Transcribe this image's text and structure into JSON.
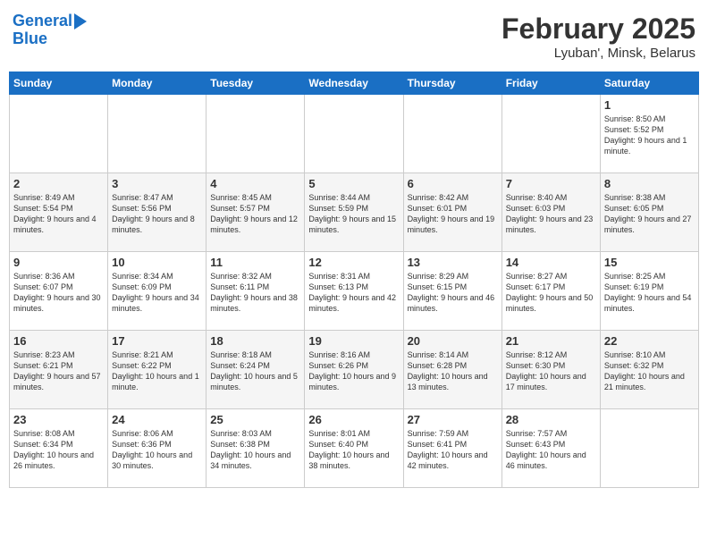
{
  "logo": {
    "line1": "General",
    "line2": "Blue"
  },
  "title": "February 2025",
  "subtitle": "Lyuban', Minsk, Belarus",
  "weekdays": [
    "Sunday",
    "Monday",
    "Tuesday",
    "Wednesday",
    "Thursday",
    "Friday",
    "Saturday"
  ],
  "weeks": [
    [
      {
        "day": "",
        "info": ""
      },
      {
        "day": "",
        "info": ""
      },
      {
        "day": "",
        "info": ""
      },
      {
        "day": "",
        "info": ""
      },
      {
        "day": "",
        "info": ""
      },
      {
        "day": "",
        "info": ""
      },
      {
        "day": "1",
        "info": "Sunrise: 8:50 AM\nSunset: 5:52 PM\nDaylight: 9 hours and 1 minute."
      }
    ],
    [
      {
        "day": "2",
        "info": "Sunrise: 8:49 AM\nSunset: 5:54 PM\nDaylight: 9 hours and 4 minutes."
      },
      {
        "day": "3",
        "info": "Sunrise: 8:47 AM\nSunset: 5:56 PM\nDaylight: 9 hours and 8 minutes."
      },
      {
        "day": "4",
        "info": "Sunrise: 8:45 AM\nSunset: 5:57 PM\nDaylight: 9 hours and 12 minutes."
      },
      {
        "day": "5",
        "info": "Sunrise: 8:44 AM\nSunset: 5:59 PM\nDaylight: 9 hours and 15 minutes."
      },
      {
        "day": "6",
        "info": "Sunrise: 8:42 AM\nSunset: 6:01 PM\nDaylight: 9 hours and 19 minutes."
      },
      {
        "day": "7",
        "info": "Sunrise: 8:40 AM\nSunset: 6:03 PM\nDaylight: 9 hours and 23 minutes."
      },
      {
        "day": "8",
        "info": "Sunrise: 8:38 AM\nSunset: 6:05 PM\nDaylight: 9 hours and 27 minutes."
      }
    ],
    [
      {
        "day": "9",
        "info": "Sunrise: 8:36 AM\nSunset: 6:07 PM\nDaylight: 9 hours and 30 minutes."
      },
      {
        "day": "10",
        "info": "Sunrise: 8:34 AM\nSunset: 6:09 PM\nDaylight: 9 hours and 34 minutes."
      },
      {
        "day": "11",
        "info": "Sunrise: 8:32 AM\nSunset: 6:11 PM\nDaylight: 9 hours and 38 minutes."
      },
      {
        "day": "12",
        "info": "Sunrise: 8:31 AM\nSunset: 6:13 PM\nDaylight: 9 hours and 42 minutes."
      },
      {
        "day": "13",
        "info": "Sunrise: 8:29 AM\nSunset: 6:15 PM\nDaylight: 9 hours and 46 minutes."
      },
      {
        "day": "14",
        "info": "Sunrise: 8:27 AM\nSunset: 6:17 PM\nDaylight: 9 hours and 50 minutes."
      },
      {
        "day": "15",
        "info": "Sunrise: 8:25 AM\nSunset: 6:19 PM\nDaylight: 9 hours and 54 minutes."
      }
    ],
    [
      {
        "day": "16",
        "info": "Sunrise: 8:23 AM\nSunset: 6:21 PM\nDaylight: 9 hours and 57 minutes."
      },
      {
        "day": "17",
        "info": "Sunrise: 8:21 AM\nSunset: 6:22 PM\nDaylight: 10 hours and 1 minute."
      },
      {
        "day": "18",
        "info": "Sunrise: 8:18 AM\nSunset: 6:24 PM\nDaylight: 10 hours and 5 minutes."
      },
      {
        "day": "19",
        "info": "Sunrise: 8:16 AM\nSunset: 6:26 PM\nDaylight: 10 hours and 9 minutes."
      },
      {
        "day": "20",
        "info": "Sunrise: 8:14 AM\nSunset: 6:28 PM\nDaylight: 10 hours and 13 minutes."
      },
      {
        "day": "21",
        "info": "Sunrise: 8:12 AM\nSunset: 6:30 PM\nDaylight: 10 hours and 17 minutes."
      },
      {
        "day": "22",
        "info": "Sunrise: 8:10 AM\nSunset: 6:32 PM\nDaylight: 10 hours and 21 minutes."
      }
    ],
    [
      {
        "day": "23",
        "info": "Sunrise: 8:08 AM\nSunset: 6:34 PM\nDaylight: 10 hours and 26 minutes."
      },
      {
        "day": "24",
        "info": "Sunrise: 8:06 AM\nSunset: 6:36 PM\nDaylight: 10 hours and 30 minutes."
      },
      {
        "day": "25",
        "info": "Sunrise: 8:03 AM\nSunset: 6:38 PM\nDaylight: 10 hours and 34 minutes."
      },
      {
        "day": "26",
        "info": "Sunrise: 8:01 AM\nSunset: 6:40 PM\nDaylight: 10 hours and 38 minutes."
      },
      {
        "day": "27",
        "info": "Sunrise: 7:59 AM\nSunset: 6:41 PM\nDaylight: 10 hours and 42 minutes."
      },
      {
        "day": "28",
        "info": "Sunrise: 7:57 AM\nSunset: 6:43 PM\nDaylight: 10 hours and 46 minutes."
      },
      {
        "day": "",
        "info": ""
      }
    ]
  ]
}
